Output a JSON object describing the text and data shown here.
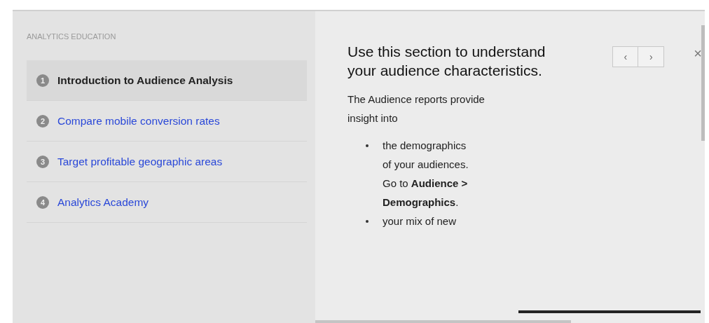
{
  "sidebar": {
    "heading": "ANALYTICS EDUCATION",
    "items": [
      {
        "number": "1",
        "label": "Introduction to Audience Analysis",
        "selected": true
      },
      {
        "number": "2",
        "label": "Compare mobile conversion rates",
        "selected": false
      },
      {
        "number": "3",
        "label": "Target profitable geographic areas",
        "selected": false
      },
      {
        "number": "4",
        "label": "Analytics Academy",
        "selected": false
      }
    ]
  },
  "content": {
    "title": "Use this section to understand your audience characteristics.",
    "nav": {
      "prev": "‹",
      "next": "›"
    },
    "close": "×",
    "intro": "The Audience reports provide insight into",
    "bullets": [
      "the demographics of your audiences. Go to **Audience > Demographics**.",
      "your mix of new"
    ]
  }
}
